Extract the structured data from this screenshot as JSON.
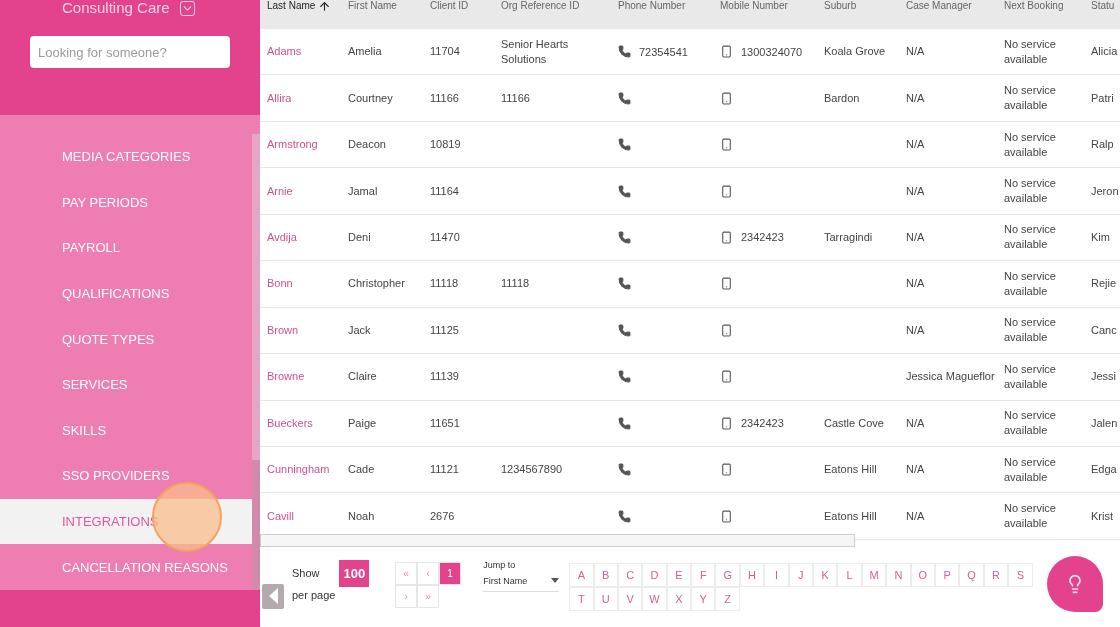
{
  "sidebar": {
    "title": "Consulting Care",
    "search": {
      "placeholder": "Looking for someone?"
    },
    "items": [
      {
        "label": "MEDIA CATEGORIES",
        "selected": false
      },
      {
        "label": "PAY PERIODS",
        "selected": false
      },
      {
        "label": "PAYROLL",
        "selected": false
      },
      {
        "label": "QUALIFICATIONS",
        "selected": false
      },
      {
        "label": "QUOTE TYPES",
        "selected": false
      },
      {
        "label": "SERVICES",
        "selected": false
      },
      {
        "label": "SKILLS",
        "selected": false
      },
      {
        "label": "SSO PROVIDERS",
        "selected": false
      },
      {
        "label": "INTEGRATIONS",
        "selected": true
      },
      {
        "label": "CANCELLATION REASONS",
        "selected": false
      }
    ]
  },
  "table": {
    "columns": [
      {
        "label": "Last Name",
        "sorted": true
      },
      {
        "label": "First Name",
        "sorted": false
      },
      {
        "label": "Client ID",
        "sorted": false
      },
      {
        "label": "Org Reference ID",
        "sorted": false
      },
      {
        "label": "Phone Number",
        "sorted": false
      },
      {
        "label": "Mobile Number",
        "sorted": false
      },
      {
        "label": "Suburb",
        "sorted": false
      },
      {
        "label": "Case Manager",
        "sorted": false
      },
      {
        "label": "Next Booking",
        "sorted": false
      },
      {
        "label": "Statu",
        "sorted": false
      }
    ],
    "rows": [
      {
        "last_name": "Adams",
        "first_name": "Amelia",
        "client_id": "11704",
        "org_ref": "Senior Hearts Solutions",
        "phone": "72354541",
        "mobile": "1300324070",
        "suburb": "Koala Grove",
        "case_manager": "N/A",
        "next_booking": "No service available",
        "status": "Alicia"
      },
      {
        "last_name": "Allira",
        "first_name": "Courtney",
        "client_id": "11166",
        "org_ref": "11166",
        "suburb": "Bardon",
        "case_manager": "N/A",
        "next_booking": "No service available",
        "status": "Patri"
      },
      {
        "last_name": "Armstrong",
        "first_name": "Deacon",
        "client_id": "10819",
        "case_manager": "N/A",
        "next_booking": "No service available",
        "status": "Ralp"
      },
      {
        "last_name": "Arnie",
        "first_name": "Jamal",
        "client_id": "11164",
        "case_manager": "N/A",
        "next_booking": "No service available",
        "status": "Jeron"
      },
      {
        "last_name": "Avdija",
        "first_name": "Deni",
        "client_id": "11470",
        "mobile": "2342423",
        "suburb": "Tarragindi",
        "case_manager": "N/A",
        "next_booking": "No service available",
        "status": "Kim"
      },
      {
        "last_name": "Bonn",
        "first_name": "Christopher",
        "client_id": "11118",
        "org_ref": "11118",
        "case_manager": "N/A",
        "next_booking": "No service available",
        "status": "Rejie"
      },
      {
        "last_name": "Brown",
        "first_name": "Jack",
        "client_id": "11125",
        "case_manager": "N/A",
        "next_booking": "No service available",
        "status": "Canc"
      },
      {
        "last_name": "Browne",
        "first_name": "Claire",
        "client_id": "11139",
        "case_manager": "Jessica Magueflor",
        "next_booking": "No service available",
        "status": "Jessi"
      },
      {
        "last_name": "Bueckers",
        "first_name": "Paige",
        "client_id": "11651",
        "mobile": "2342423",
        "suburb": "Castle Cove",
        "case_manager": "N/A",
        "next_booking": "No service available",
        "status": "Jalen"
      },
      {
        "last_name": "Cunningham",
        "first_name": "Cade",
        "client_id": "11121",
        "org_ref": "1234567890",
        "suburb": "Eatons Hill",
        "case_manager": "N/A",
        "next_booking": "No service available",
        "status": "Edga"
      },
      {
        "last_name": "Cavill",
        "first_name": "Noah",
        "client_id": "2676",
        "suburb": "Eatons Hill",
        "case_manager": "N/A",
        "next_booking": "No service available",
        "status": "Krist"
      }
    ]
  },
  "footer": {
    "show_label": "Show",
    "page_size": "100",
    "per_page_label": "per page",
    "pages": [
      {
        "label": "«",
        "selected": false
      },
      {
        "label": "‹",
        "selected": false
      },
      {
        "label": "1",
        "selected": true
      },
      {
        "label": "›",
        "selected": false
      },
      {
        "label": "»",
        "selected": false
      }
    ],
    "jump": {
      "label": "Jump to",
      "value": "First Name"
    },
    "letters": [
      "A",
      "B",
      "C",
      "D",
      "E",
      "F",
      "G",
      "H",
      "I",
      "J",
      "K",
      "L",
      "M",
      "N",
      "O",
      "P",
      "Q",
      "R",
      "S",
      "T",
      "U",
      "V",
      "W",
      "X",
      "Y",
      "Z"
    ]
  }
}
